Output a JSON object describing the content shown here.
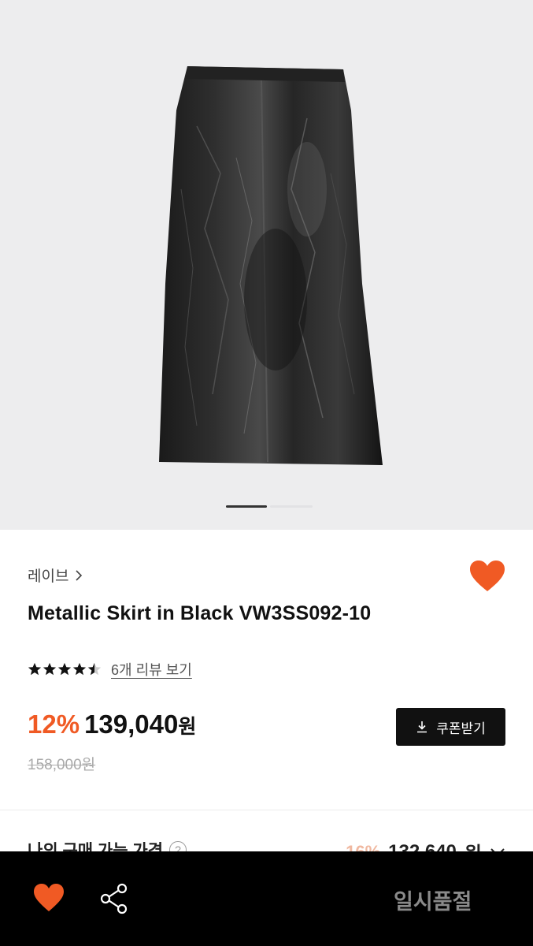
{
  "brand": {
    "name": "레이브"
  },
  "product": {
    "title": "Metallic Skirt in Black VW3SS092-10"
  },
  "rating": {
    "value": 4.5,
    "max": 5,
    "review_link": "6개 리뷰 보기"
  },
  "pricing": {
    "discount": "12%",
    "price": "139,040",
    "currency": "원",
    "original_price": "158,000원"
  },
  "coupon": {
    "label": "쿠폰받기",
    "icon": "download-icon"
  },
  "my_price": {
    "label": "나의 구매 가능 가격",
    "help_icon": "?",
    "discount": "16%",
    "amount": "132,640",
    "currency": "원"
  },
  "gallery": {
    "current": 1
  },
  "bottom_bar": {
    "cta": "일시품절"
  },
  "colors": {
    "accent": "#f05a24",
    "bar": "#000000",
    "sold_out_text": "#8a8a8a"
  }
}
